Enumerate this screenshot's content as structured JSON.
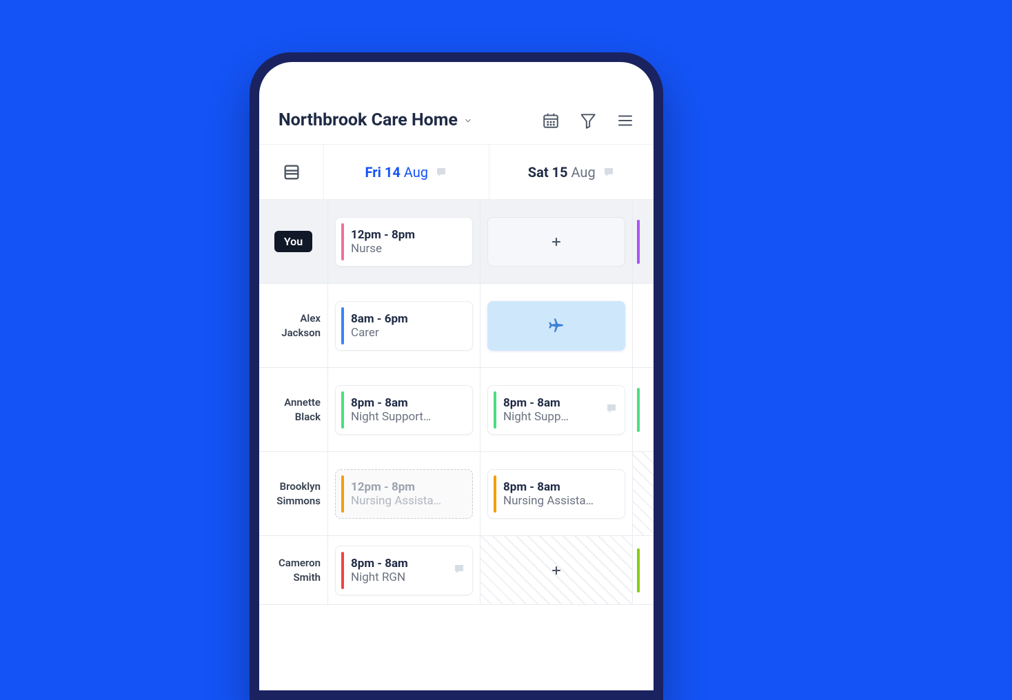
{
  "header": {
    "location_name": "Northbrook Care Home"
  },
  "dates": [
    {
      "short": "Fri 14",
      "month": "Aug",
      "active": true
    },
    {
      "short": "Sat 15",
      "month": "Aug",
      "active": false
    }
  ],
  "colors": {
    "pink": "#f06fa0",
    "blue": "#3b82f6",
    "green": "#4ade80",
    "orange": "#f59e0b",
    "red": "#ef4444",
    "purple": "#a855f7",
    "lime": "#84cc16"
  },
  "rows": [
    {
      "is_you": true,
      "name": "You",
      "cells": [
        {
          "type": "shift",
          "time": "12pm - 8pm",
          "role": "Nurse",
          "color": "pink"
        },
        {
          "type": "add"
        }
      ],
      "partial": {
        "color": "purple"
      }
    },
    {
      "name_line1": "Alex",
      "name_line2": "Jackson",
      "cells": [
        {
          "type": "shift",
          "time": "8am - 6pm",
          "role": "Carer",
          "color": "blue"
        },
        {
          "type": "leave"
        }
      ]
    },
    {
      "name_line1": "Annette",
      "name_line2": "Black",
      "cells": [
        {
          "type": "shift",
          "time": "8pm - 8am",
          "role": "Night Support…",
          "color": "green"
        },
        {
          "type": "shift",
          "time": "8pm - 8am",
          "role": "Night Supp…",
          "color": "green",
          "comment": true
        }
      ],
      "partial": {
        "color": "green"
      }
    },
    {
      "name_line1": "Brooklyn",
      "name_line2": "Simmons",
      "cells": [
        {
          "type": "shift",
          "time": "12pm - 8pm",
          "role": "Nursing Assista…",
          "color": "orange",
          "draft": true
        },
        {
          "type": "shift",
          "time": "8pm - 8am",
          "role": "Nursing Assista…",
          "color": "orange"
        }
      ],
      "partial_hatched": true
    },
    {
      "name_line1": "Cameron",
      "name_line2": "Smith",
      "cells": [
        {
          "type": "shift",
          "time": "8pm - 8am",
          "role": "Night RGN",
          "color": "red",
          "comment": true
        },
        {
          "type": "add",
          "hatched": true
        }
      ],
      "partial": {
        "color": "lime"
      }
    }
  ]
}
